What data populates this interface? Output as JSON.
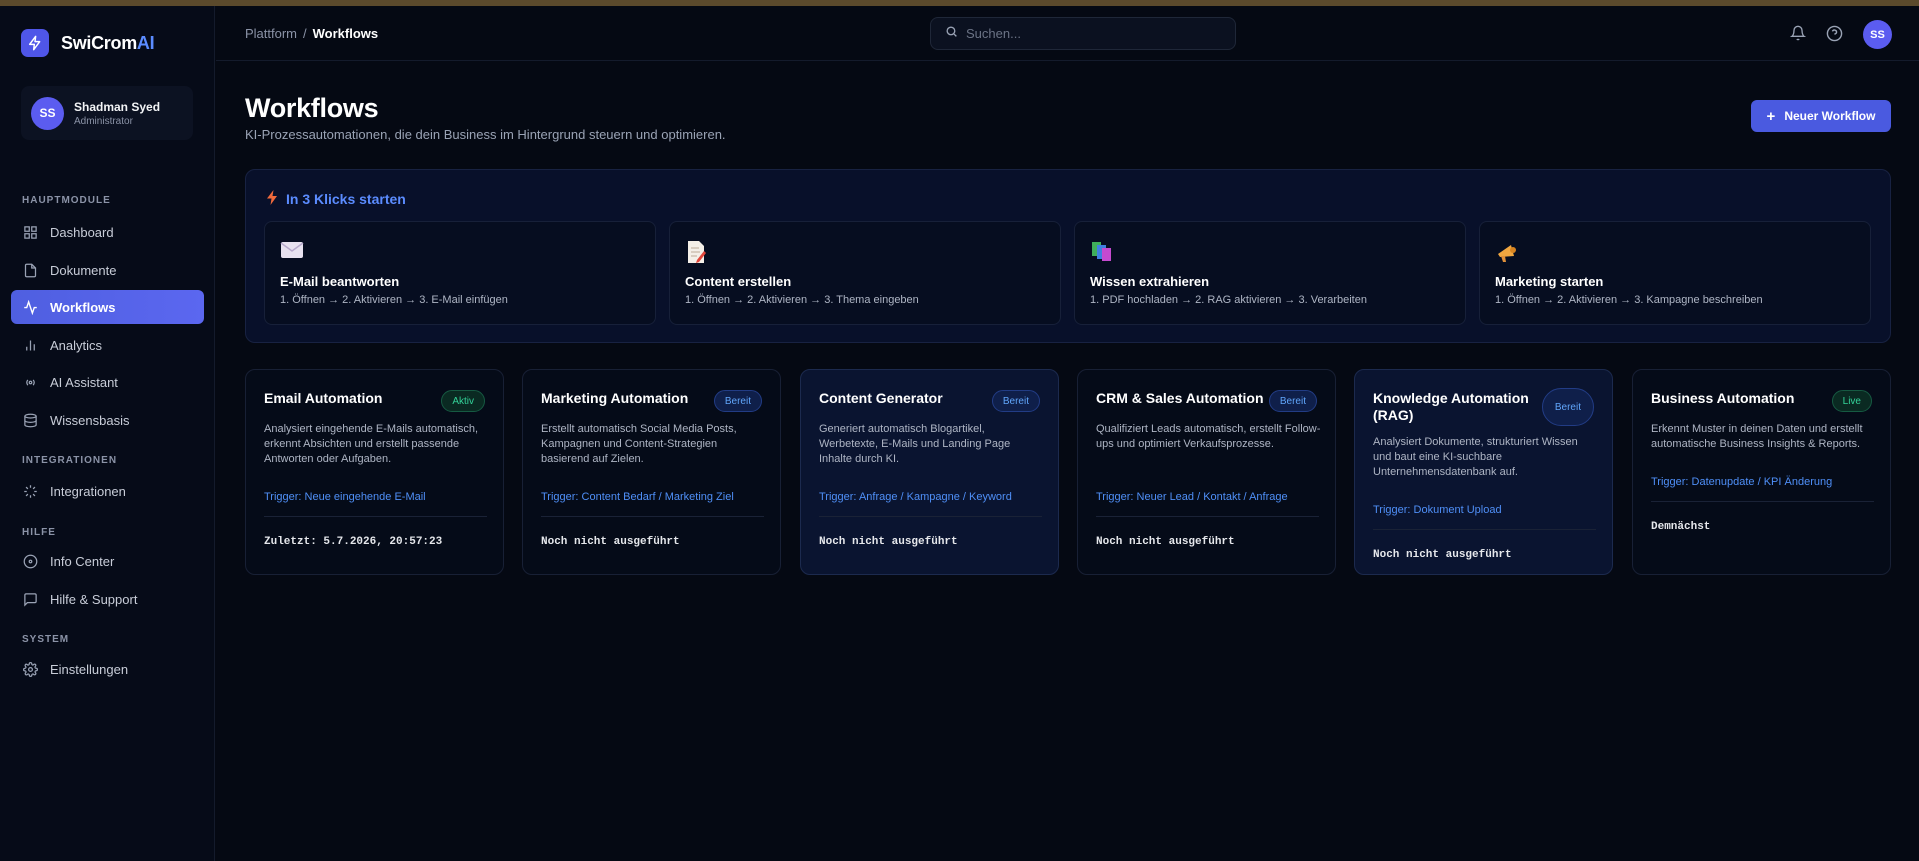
{
  "brand": {
    "name": "SwiCrom",
    "accent": "AI"
  },
  "user": {
    "initials": "SS",
    "name": "Shadman Syed",
    "role": "Administrator"
  },
  "sidebar": {
    "sections": [
      {
        "title": "HAUPTMODULE"
      },
      {
        "title": "INTEGRATIONEN"
      },
      {
        "title": "HILFE"
      },
      {
        "title": "SYSTEM"
      }
    ],
    "items": [
      {
        "label": "Dashboard",
        "icon": "grid-icon"
      },
      {
        "label": "Dokumente",
        "icon": "document-icon"
      },
      {
        "label": "Workflows",
        "icon": "activity-icon",
        "active": true
      },
      {
        "label": "Analytics",
        "icon": "bar-chart-icon"
      },
      {
        "label": "AI Assistant",
        "icon": "radio-icon"
      },
      {
        "label": "Wissensbasis",
        "icon": "database-icon"
      },
      {
        "label": "Integrationen",
        "icon": "loader-icon"
      },
      {
        "label": "Info Center",
        "icon": "info-icon"
      },
      {
        "label": "Hilfe & Support",
        "icon": "message-icon"
      },
      {
        "label": "Einstellungen",
        "icon": "gear-icon"
      }
    ]
  },
  "header": {
    "breadcrumb": [
      "Plattform",
      "/",
      "Workflows"
    ],
    "search_placeholder": "Suchen...",
    "avatar": "SS"
  },
  "main": {
    "title": "Workflows",
    "subtitle": "KI-Prozessautomationen, die dein Business im Hintergrund steuern und optimieren.",
    "new_button": "Neuer Workflow",
    "quick_title": "In 3 Klicks starten",
    "quick_cards": [
      {
        "title": "E-Mail beantworten",
        "steps": "1. Öffnen → 2. Aktivieren → 3. E-Mail einfügen",
        "icon": "envelope-icon"
      },
      {
        "title": "Content erstellen",
        "steps": "1. Öffnen → 2. Aktivieren → 3. Thema eingeben",
        "icon": "memo-icon"
      },
      {
        "title": "Wissen extrahieren",
        "steps": "1. PDF hochladen → 2. RAG aktivieren → 3. Verarbeiten",
        "icon": "books-icon"
      },
      {
        "title": "Marketing starten",
        "steps": "1. Öffnen → 2. Aktivieren → 3. Kampagne beschreiben",
        "icon": "megaphone-icon"
      }
    ],
    "workflows": [
      {
        "title": "Email Automation",
        "badge": "Aktiv",
        "badge_color": "green",
        "desc": "Analysiert eingehende E-Mails automatisch, erkennt Absichten und erstellt passende Antworten oder Aufgaben.",
        "trigger": "Trigger: Neue eingehende E-Mail",
        "status": "Zuletzt: 5.7.2026, 20:57:23"
      },
      {
        "title": "Marketing Automation",
        "badge": "Bereit",
        "badge_color": "blue",
        "desc": "Erstellt automatisch Social Media Posts, Kampagnen und Content-Strategien basierend auf Zielen.",
        "trigger": "Trigger: Content Bedarf / Marketing Ziel",
        "status": "Noch nicht ausgeführt"
      },
      {
        "title": "Content Generator",
        "badge": "Bereit",
        "badge_color": "blue",
        "desc": "Generiert automatisch Blogartikel, Werbetexte, E-Mails und Landing Page Inhalte durch KI.",
        "trigger": "Trigger: Anfrage / Kampagne / Keyword",
        "status": "Noch nicht ausgeführt"
      },
      {
        "title": "CRM & Sales Automation",
        "badge": "Bereit",
        "badge_color": "blue",
        "desc": "Qualifiziert Leads automatisch, erstellt Follow-ups und optimiert Verkaufsprozesse.",
        "trigger": "Trigger: Neuer Lead / Kontakt / Anfrage",
        "status": "Noch nicht ausgeführt"
      },
      {
        "title": "Knowledge Automation (RAG)",
        "badge": "Bereit",
        "badge_color": "blue",
        "desc": "Analysiert Dokumente, strukturiert Wissen und baut eine KI-suchbare Unternehmensdatenbank auf.",
        "trigger": "Trigger: Dokument Upload",
        "status": "Noch nicht ausgeführt"
      },
      {
        "title": "Business Automation",
        "badge": "Live",
        "badge_color": "green",
        "desc": "Erkennt Muster in deinen Daten und erstellt automatische Business Insights & Reports.",
        "trigger": "Trigger: Datenupdate / KPI Änderung",
        "status": "Demnächst"
      }
    ]
  },
  "colors": {
    "accent": "#4f5fe0",
    "background": "#050913",
    "success": "#34d399",
    "info": "#60a5fa"
  }
}
